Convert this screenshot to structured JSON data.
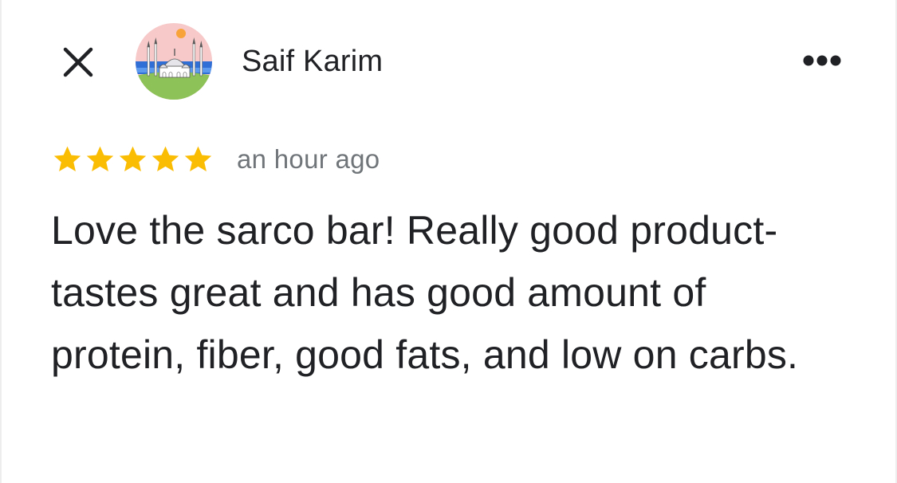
{
  "review": {
    "author_name": "Saif Karim",
    "rating": 5,
    "rating_max": 5,
    "timestamp": "an hour ago",
    "text": "Love the sarco bar! Really good product- tastes great and has good amount of protein, fiber, good fats, and low on carbs."
  },
  "icons": {
    "close": "close-icon",
    "more": "more-horizontal-icon",
    "star": "star-icon",
    "avatar": "mosque-illustration-avatar"
  },
  "colors": {
    "star_fill": "#fbbc04",
    "text_primary": "#202124",
    "text_secondary": "#70757a"
  }
}
